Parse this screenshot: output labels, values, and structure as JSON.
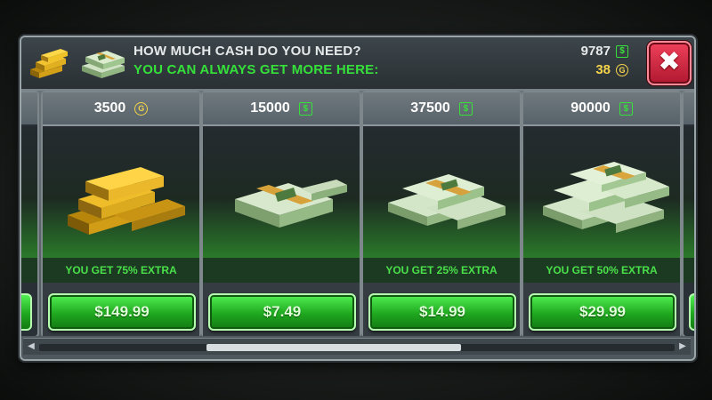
{
  "header": {
    "title": "HOW MUCH CASH DO YOU NEED?",
    "subtitle": "YOU CAN ALWAYS GET MORE HERE:",
    "cash_balance": "9787",
    "gold_balance": "38",
    "close_label": "✖"
  },
  "currency_glyphs": {
    "cash": "$",
    "gold": "G"
  },
  "offers": [
    {
      "amount": "3500",
      "currency": "gold",
      "extra": "YOU GET 75% EXTRA",
      "price": "$149.99",
      "art": "gold-bars"
    },
    {
      "amount": "15000",
      "currency": "cash",
      "extra": "",
      "price": "$7.49",
      "art": "cash-stack-small"
    },
    {
      "amount": "37500",
      "currency": "cash",
      "extra": "YOU GET 25% EXTRA",
      "price": "$14.99",
      "art": "cash-pile-medium"
    },
    {
      "amount": "90000",
      "currency": "cash",
      "extra": "YOU GET 50% EXTRA",
      "price": "$29.99",
      "art": "cash-pile-large"
    }
  ],
  "colors": {
    "accent_green": "#35e03a",
    "gold": "#f4d34a",
    "close_red": "#d8243c",
    "price_button_green": "#1fa81f"
  },
  "scroll": {
    "position_fraction": 0.44,
    "visible_fraction": 0.4
  }
}
